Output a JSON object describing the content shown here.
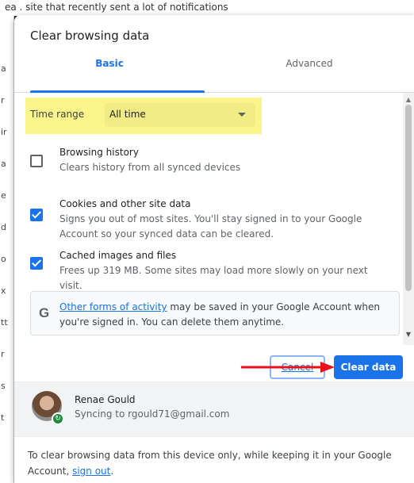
{
  "background": {
    "strip_text": "ea  .  site that recently sent a lot of notifications",
    "edge_chars": [
      "a",
      "r",
      "ir",
      "a",
      "e",
      "d",
      "o",
      "x",
      "tt",
      "r",
      "s",
      "t"
    ]
  },
  "dialog": {
    "title": "Clear browsing data",
    "tabs": [
      {
        "label": "Basic",
        "active": true
      },
      {
        "label": "Advanced",
        "active": false
      }
    ],
    "time_range": {
      "label": "Time range",
      "value": "All time",
      "highlight_color": "#faf58a"
    },
    "options": [
      {
        "title": "Browsing history",
        "description": "Clears history from all synced devices",
        "checked": false
      },
      {
        "title": "Cookies and other site data",
        "description": "Signs you out of most sites. You'll stay signed in to your Google Account so your synced data can be cleared.",
        "checked": true
      },
      {
        "title": "Cached images and files",
        "description": "Frees up 319 MB. Some sites may load more slowly on your next visit.",
        "checked": true
      }
    ],
    "info": {
      "icon": "google-g-icon",
      "link_text": "Other forms of activity",
      "text": " may be saved in your Google Account when you're signed in. You can delete them anytime."
    },
    "buttons": {
      "cancel": "Cancel",
      "clear": "Clear data"
    },
    "account": {
      "name": "Renae Gould",
      "sync_text": "Syncing to rgould71@gmail.com"
    },
    "footer": {
      "text": "To clear browsing data from this device only, while keeping it in your Google Account, ",
      "link": "sign out",
      "suffix": "."
    }
  },
  "colors": {
    "accent": "#1a73e8",
    "annotation_arrow": "#e8101a"
  }
}
